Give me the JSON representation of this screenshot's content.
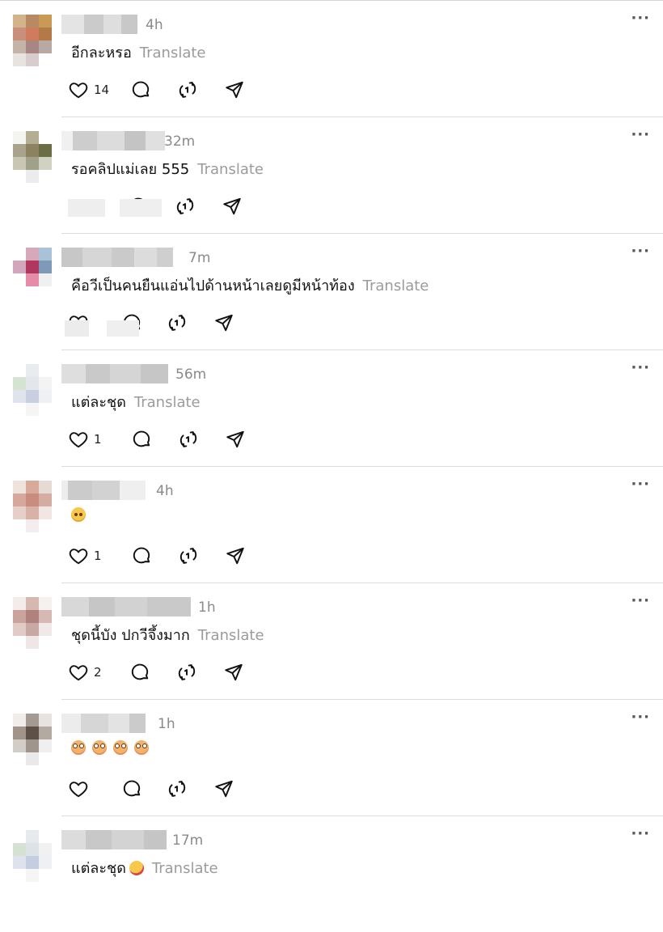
{
  "ui": {
    "more_label": "···",
    "translate_label": "Translate"
  },
  "icons": {
    "like": "heart-icon",
    "reply": "comment-bubble-icon",
    "repost": "repost-icon",
    "share": "send-icon",
    "more": "more-options-icon"
  },
  "comments": [
    {
      "time": "4h",
      "text": "อีกละหรอ",
      "likes": "14",
      "has_translate": true
    },
    {
      "time": "32m",
      "text": "รอคลิปแม่เลย 555",
      "likes": "",
      "has_translate": true
    },
    {
      "time": "7m",
      "text": "คือวีเป็นคนยืนแอ่นไปด้านหน้าเลยดูมีหน้าท้อง",
      "likes": "",
      "has_translate": true
    },
    {
      "time": "56m",
      "text": "แต่ละชุด",
      "likes": "1",
      "has_translate": true
    },
    {
      "time": "4h",
      "text": "",
      "likes": "1",
      "has_translate": false,
      "emoji": [
        "blush"
      ]
    },
    {
      "time": "1h",
      "text": "ชุดนี้บัง ปกวีจึ้งมาก",
      "likes": "2",
      "has_translate": true
    },
    {
      "time": "1h",
      "text": "",
      "likes": "",
      "has_translate": false,
      "emoji": [
        "flushed",
        "flushed",
        "flushed",
        "flushed"
      ]
    },
    {
      "time": "17m",
      "text": "แต่ละชุด",
      "likes": "",
      "has_translate": true,
      "emoji_after": [
        "rofl"
      ]
    }
  ]
}
